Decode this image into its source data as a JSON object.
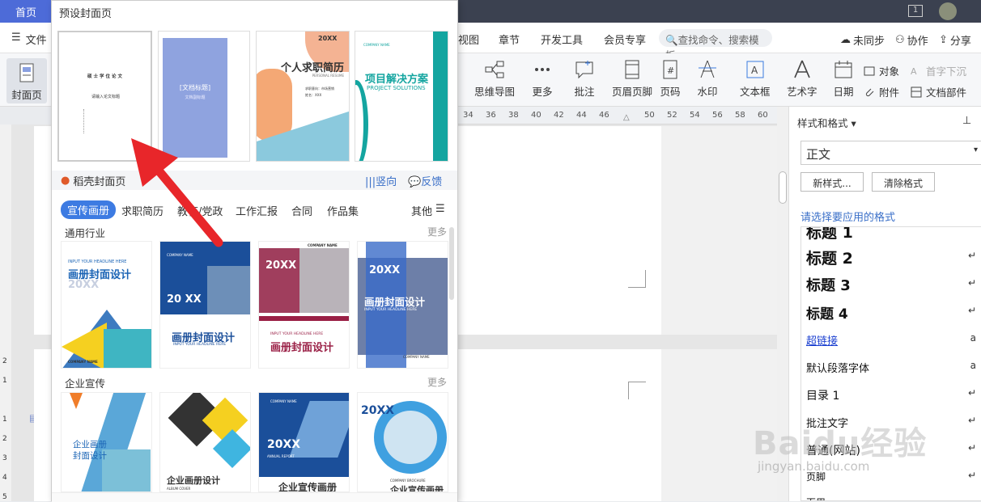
{
  "topbar": {
    "home_tab": "首页"
  },
  "menubar": {
    "file": "文件",
    "items": [
      "视图",
      "章节",
      "开发工具",
      "会员专享"
    ],
    "search_placeholder": "查找命令、搜索模板",
    "sync": "未同步",
    "collab": "协作",
    "share": "分享"
  },
  "toolbar": {
    "cover": "封面页",
    "mindmap": "思维导图",
    "more": "更多",
    "comment": "批注",
    "header_footer": "页眉页脚",
    "page_number": "页码",
    "watermark": "水印",
    "textbox": "文本框",
    "art_text": "艺术字",
    "date": "日期",
    "object": "对象",
    "attachment": "附件",
    "drop_cap": "首字下沉",
    "doc_parts": "文档部件"
  },
  "ruler": [
    "34",
    "36",
    "38",
    "40",
    "42",
    "44",
    "46",
    "50",
    "52",
    "54",
    "56",
    "58",
    "60"
  ],
  "left_ruler": [
    "2",
    "1",
    "1",
    "2",
    "3",
    "4",
    "5"
  ],
  "styles_panel": {
    "title": "样式和格式",
    "current_style": "正文",
    "new_style_btn": "新样式...",
    "clear_btn": "清除格式",
    "prompt": "请选择要应用的格式",
    "items": [
      "标题 1",
      "标题 2",
      "标题 3",
      "标题 4",
      "超链接",
      "默认段落字体",
      "目录 1",
      "批注文字",
      "普通(网站)",
      "页脚",
      "页眉"
    ]
  },
  "cover_panel": {
    "title": "预设封面页",
    "preset_thumbs": [
      {
        "title": "硕士学位论文",
        "subtitle": "请输入论文标题"
      },
      {
        "title": "[文档标题]",
        "subtitle": "文档副标题"
      },
      {
        "year": "20XX",
        "title": "个人求职简历",
        "subtitle": "PERSONAL RESUME",
        "fields": [
          "求职意向：市场营销",
          "姓名：XXX"
        ]
      },
      {
        "company": "COMPANY NAME",
        "title": "项目解决方案",
        "subtitle": "PROJECT SOLUTIONS"
      }
    ],
    "brand": "稻壳封面页",
    "vertical": "竖向",
    "feedback": "反馈",
    "categories": [
      "宣传画册",
      "求职简历",
      "教育/党政",
      "工作汇报",
      "合同",
      "作品集"
    ],
    "other": "其他",
    "sections": [
      {
        "title": "通用行业",
        "more": "更多",
        "cards": [
          {
            "headline": "INPUT YOUR HEADLINE HERE",
            "title": "画册封面设计",
            "year": "20XX",
            "company": "COMPANY NAME"
          },
          {
            "company": "COMPANY NAME",
            "year": "20 XX",
            "title": "画册封面设计",
            "headline": "INPUT YOUR HEADLINE HERE"
          },
          {
            "company": "COMPANY NAME",
            "year": "20XX",
            "headline": "INPUT YOUR HEADLINE HERE",
            "title": "画册封面设计"
          },
          {
            "year": "20XX",
            "title": "画册封面设计",
            "headline": "INPUT YOUR HEADLINE HERE",
            "company": "COMPANY NAME"
          }
        ]
      },
      {
        "title": "企业宣传",
        "more": "更多",
        "cards": [
          {
            "title": "企业画册封面设计"
          },
          {
            "title": "企业画册设计",
            "subtitle": "ALBUM COVER"
          },
          {
            "company": "COMPANY NAME",
            "year": "20XX",
            "subtitle": "ANNUAL REPORT",
            "title": "企业宣传画册"
          },
          {
            "year": "20XX",
            "company": "COMPANY BROCHURE",
            "title": "企业宣传画册"
          }
        ]
      }
    ]
  },
  "watermark": {
    "logo": "Baidu经验",
    "url": "jingyan.baidu.com"
  },
  "colors": {
    "accent": "#4d6bd8",
    "arrow": "#e8262a",
    "topbar": "#3b4150"
  }
}
